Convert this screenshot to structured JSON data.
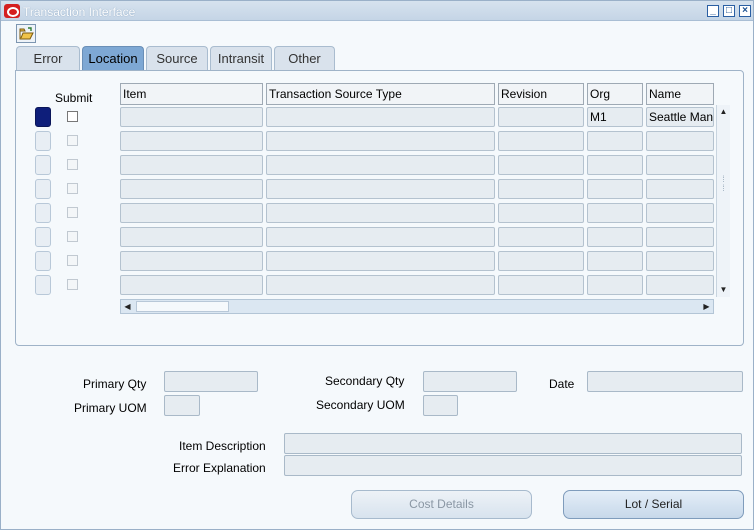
{
  "window": {
    "title": "Transaction Interface"
  },
  "tabs": [
    "Error",
    "Location",
    "Source",
    "Intransit",
    "Other"
  ],
  "active_tab": "Location",
  "grid": {
    "submit_label": "Submit",
    "columns": [
      "Item",
      "Transaction Source Type",
      "Revision",
      "Org",
      "Name"
    ],
    "rows": [
      {
        "item": "",
        "source_type": "",
        "revision": "",
        "org": "M1",
        "name": "Seattle Man"
      },
      {
        "item": "",
        "source_type": "",
        "revision": "",
        "org": "",
        "name": ""
      },
      {
        "item": "",
        "source_type": "",
        "revision": "",
        "org": "",
        "name": ""
      },
      {
        "item": "",
        "source_type": "",
        "revision": "",
        "org": "",
        "name": ""
      },
      {
        "item": "",
        "source_type": "",
        "revision": "",
        "org": "",
        "name": ""
      },
      {
        "item": "",
        "source_type": "",
        "revision": "",
        "org": "",
        "name": ""
      },
      {
        "item": "",
        "source_type": "",
        "revision": "",
        "org": "",
        "name": ""
      },
      {
        "item": "",
        "source_type": "",
        "revision": "",
        "org": "",
        "name": ""
      }
    ]
  },
  "fields": {
    "primary_qty": "Primary Qty",
    "primary_uom": "Primary UOM",
    "secondary_qty": "Secondary Qty",
    "secondary_uom": "Secondary UOM",
    "date": "Date",
    "item_description": "Item Description",
    "error_explanation": "Error Explanation"
  },
  "buttons": {
    "cost_details": "Cost Details",
    "lot_serial": "Lot / Serial"
  },
  "icons": {
    "window_logo": "oracle-logo-icon",
    "toolbar": "open-folder-icon"
  },
  "colors": {
    "active_tab": "#7ea8d4",
    "current_row_marker": "#0e1e7a",
    "oracle_red": "#d41f1f"
  }
}
